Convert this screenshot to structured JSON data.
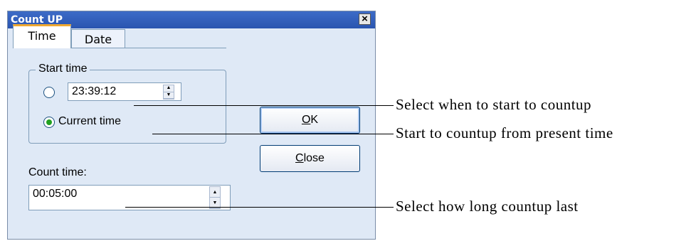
{
  "window": {
    "title": "Count UP"
  },
  "tabs": [
    {
      "label": "Time"
    },
    {
      "label": "Date"
    }
  ],
  "start_group": {
    "label": "Start time",
    "start_time_value": "23:39:12",
    "current_time_label": "Current time",
    "selected_option": "Current time"
  },
  "count_time": {
    "label": "Count time:",
    "value": "00:05:00"
  },
  "buttons": {
    "ok_label": "OK",
    "close_label": "Close"
  },
  "callouts": [
    "Select when to start to countup",
    "Start to countup from present time",
    "Select how long countup last"
  ],
  "colors": {
    "title_bar": "#2a55b0",
    "dialog_bg": "#dfe9f6",
    "radio_selected": "#21a121",
    "tab_highlight": "#f0a830"
  }
}
